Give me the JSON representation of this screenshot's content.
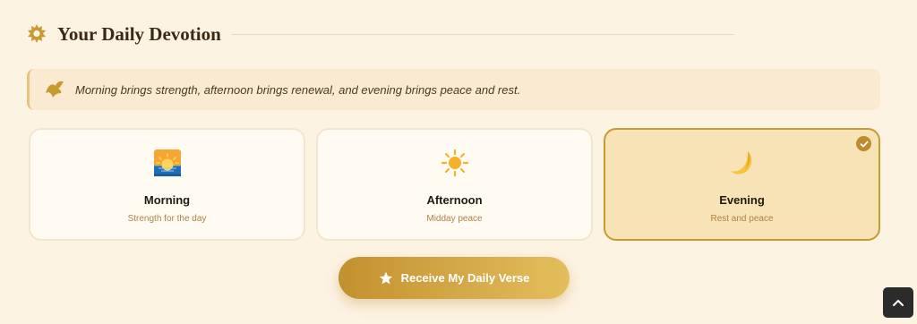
{
  "section": {
    "title": "Your Daily Devotion",
    "icon": "sun-badge-icon"
  },
  "quote": {
    "icon": "dove-icon",
    "text": "Morning brings strength, afternoon brings renewal, and evening brings peace and rest."
  },
  "options": [
    {
      "icon": "sunrise-icon",
      "title": "Morning",
      "subtitle": "Strength for the day",
      "selected": false
    },
    {
      "icon": "sun-icon",
      "title": "Afternoon",
      "subtitle": "Midday peace",
      "selected": false
    },
    {
      "icon": "crescent-moon-icon",
      "title": "Evening",
      "subtitle": "Rest and peace",
      "selected": true
    }
  ],
  "cta": {
    "label": "Receive My Daily Verse",
    "icon": "star-icon"
  },
  "scroll_top": {
    "icon": "chevron-up-icon"
  },
  "colors": {
    "background": "#fdf3e3",
    "accent": "#c99a34",
    "selected_card": "#f7e3b5"
  }
}
